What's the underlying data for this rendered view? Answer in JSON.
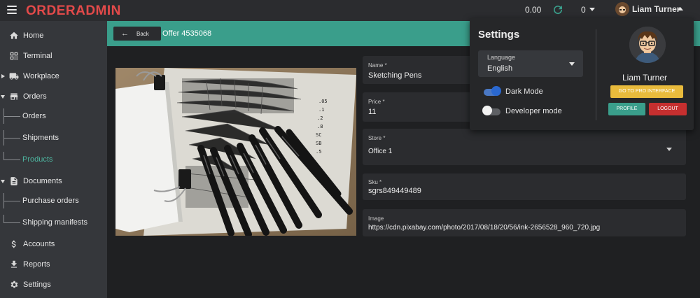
{
  "app": {
    "logo": "ORDERADMIN"
  },
  "topbar": {
    "balance": "0.00",
    "count": "0",
    "user_name": "Liam Turner"
  },
  "sidebar": {
    "home": "Home",
    "terminal": "Terminal",
    "workplace": "Workplace",
    "orders": "Orders",
    "orders_sub": [
      "Orders",
      "Shipments",
      "Products"
    ],
    "documents": "Documents",
    "documents_sub": [
      "Purchase orders",
      "Shipping manifests"
    ],
    "accounts": "Accounts",
    "reports": "Reports",
    "settings": "Settings"
  },
  "offer": {
    "back_label": "Back",
    "title": "Offer 4535068"
  },
  "form": {
    "name": {
      "label": "Name *",
      "value": "Sketching Pens"
    },
    "price": {
      "label": "Price *",
      "value": "11"
    },
    "store": {
      "label": "Store *",
      "value": "Office 1"
    },
    "sku": {
      "label": "Sku *",
      "value": "sgrs849449489"
    },
    "image": {
      "label": "Image",
      "value": "https://cdn.pixabay.com/photo/2017/08/18/20/56/ink-2656528_960_720.jpg"
    }
  },
  "settings_panel": {
    "title": "Settings",
    "language_label": "Language",
    "language_value": "English",
    "dark_mode_label": "Dark Mode",
    "dark_mode_on": true,
    "developer_mode_label": "Developer mode",
    "developer_mode_on": false,
    "user_name": "Liam Turner",
    "pro_button": "GO TO PRO INTERFACE",
    "profile_button": "PROFILE",
    "logout_button": "LOGOUT"
  },
  "colors": {
    "accent": "#3a9e8b",
    "logo": "#e34a4a",
    "pro": "#e9bb3c",
    "logout": "#c62f2f",
    "toggle_on": "#2a68d0"
  },
  "icons": [
    "menu-icon",
    "refresh-icon",
    "home-icon",
    "terminal-icon",
    "truck-icon",
    "store-icon",
    "document-icon",
    "dollar-icon",
    "download-icon",
    "gear-icon"
  ]
}
